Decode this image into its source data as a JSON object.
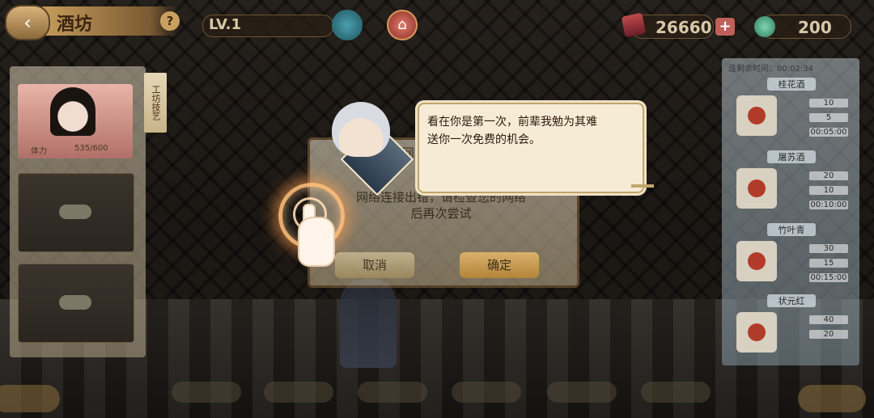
{
  "header": {
    "title": "酒坊",
    "level": "LV.1",
    "coins": "26660",
    "gems": "200"
  },
  "left_panel": {
    "stamina_label": "体力",
    "stamina_value": "535/600",
    "side_tag": "工坊技艺"
  },
  "right_panel": {
    "timer_label": "连剩余时间：",
    "timer_value": "00:02:34",
    "recipes": [
      {
        "name": "桂花酒",
        "a": "10",
        "b": "5",
        "time": "00:05:00"
      },
      {
        "name": "屠苏酒",
        "a": "20",
        "b": "10",
        "time": "00:10:00"
      },
      {
        "name": "竹叶青",
        "a": "30",
        "b": "15",
        "time": "00:15:00"
      },
      {
        "name": "状元红",
        "a": "40",
        "b": "20",
        "time": ""
      }
    ]
  },
  "dialog": {
    "title": "网",
    "message_line1": "网络连接出错，请检查您的网络",
    "message_line2": "后再次尝试",
    "cancel": "取消",
    "confirm": "确定"
  },
  "npc": {
    "speech_line1": "看在你是第一次，前辈我勉为其难",
    "speech_line2": "送你一次免费的机会。"
  },
  "icons": {
    "back": "arrow-left-icon",
    "help": "question-icon",
    "home": "home-icon",
    "plus": "plus-icon"
  }
}
